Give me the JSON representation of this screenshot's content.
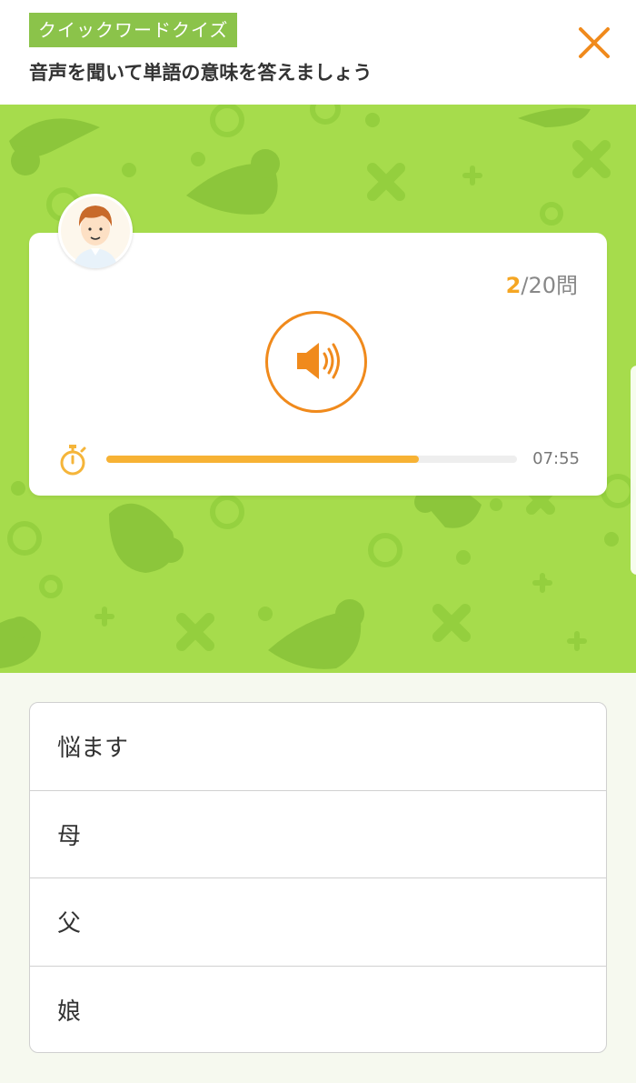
{
  "header": {
    "badge": "クイックワードクイズ",
    "instruction": "音声を聞いて単語の意味を答えましょう",
    "close_icon": "close-icon"
  },
  "colors": {
    "accent_orange": "#f08a1c",
    "badge_green": "#8bc34a",
    "hero_green": "#a6dc4c",
    "progress_yellow": "#f7b234"
  },
  "quiz": {
    "current": "2",
    "total": "/20問",
    "speaker_icon": "speaker-icon",
    "timer_icon": "stopwatch-icon",
    "time_remaining": "07:55",
    "progress_fraction": 0.76
  },
  "answers": [
    {
      "label": "悩ます"
    },
    {
      "label": "母"
    },
    {
      "label": "父"
    },
    {
      "label": "娘"
    }
  ]
}
